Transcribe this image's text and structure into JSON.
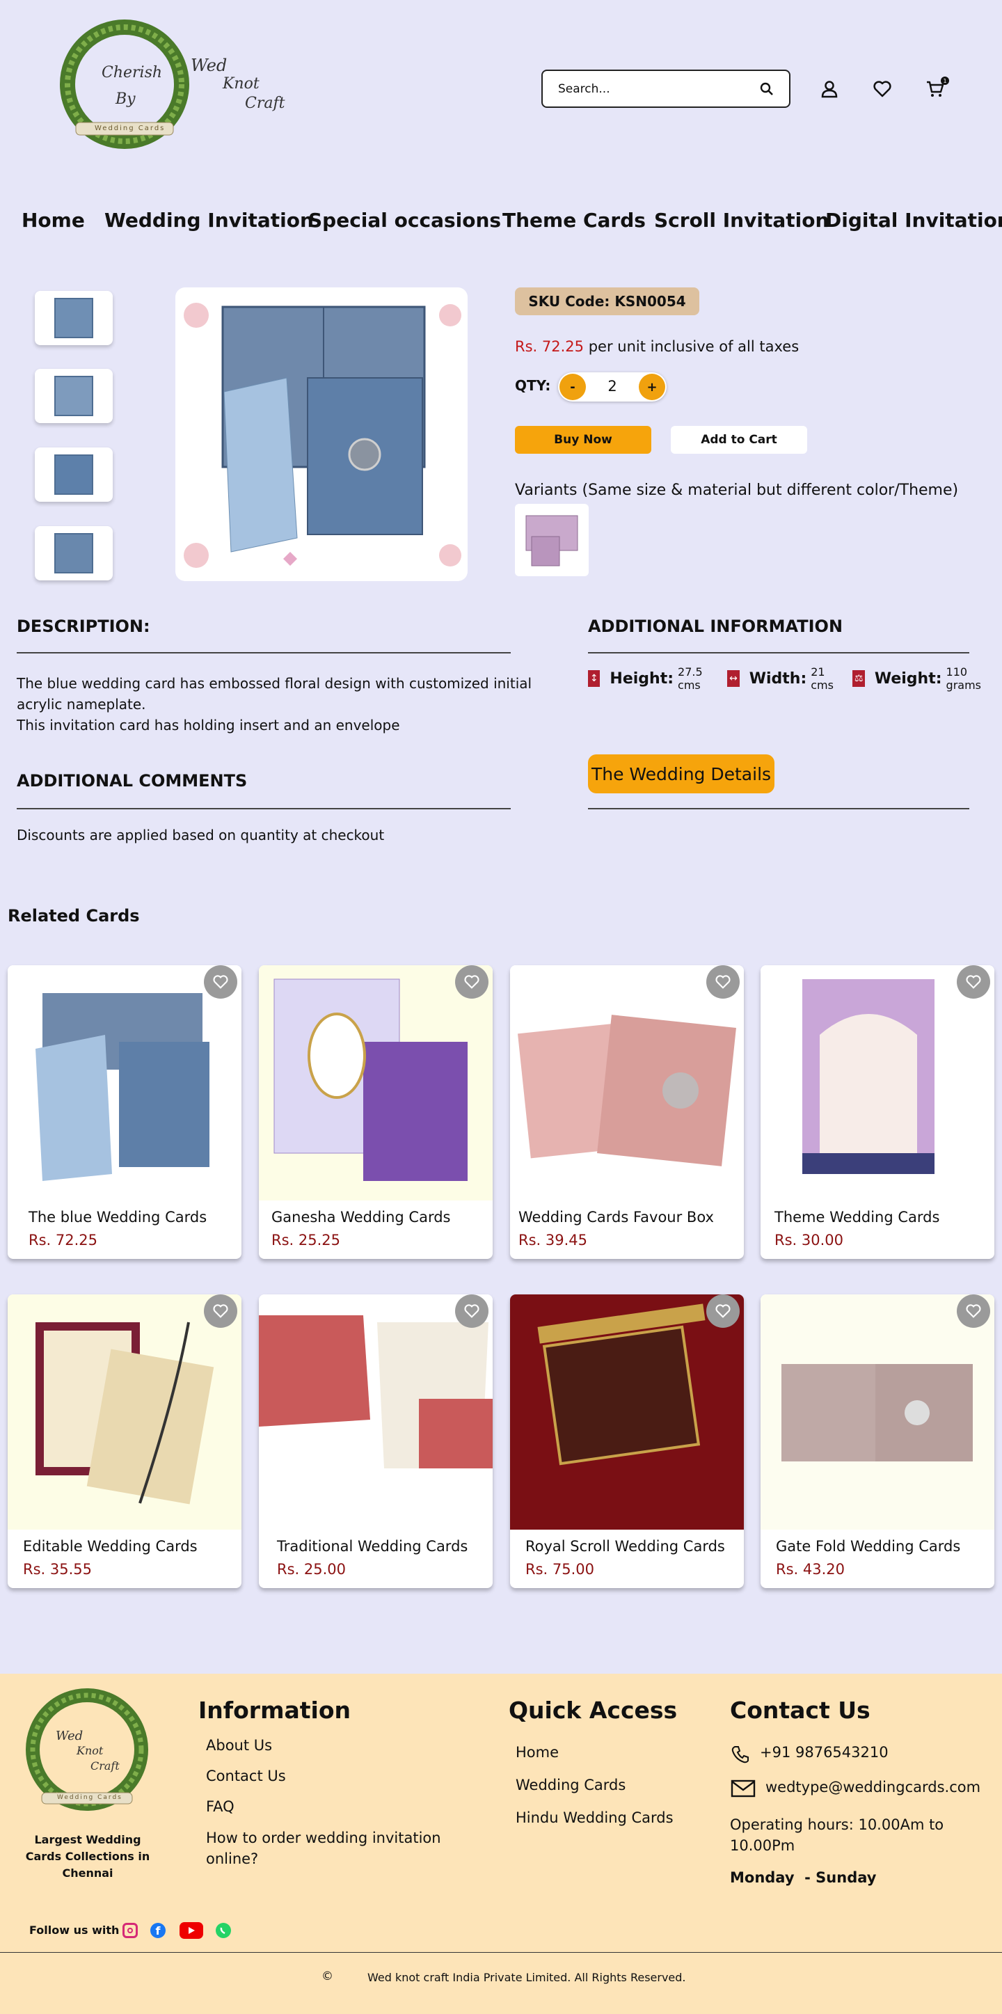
{
  "header": {
    "logo_text": [
      "Cherish",
      "By",
      "Wed",
      "Knot",
      "Craft",
      "Wedding Cards"
    ],
    "search_placeholder": "Search...",
    "cart_count": "1"
  },
  "nav": [
    "Home",
    "Wedding Invitation",
    "Special occasions",
    "Theme Cards",
    "Scroll Invitation",
    "Digital Invitation"
  ],
  "product": {
    "sku": "SKU Code: KSN0054",
    "price": "Rs. 72.25",
    "price_suffix": "per unit inclusive of all taxes",
    "qty_label": "QTY:",
    "qty_minus": "-",
    "qty_value": "2",
    "qty_plus": "+",
    "buy_now": "Buy Now",
    "add_to_cart": "Add to Cart",
    "variants_label": "Variants (Same size & material but different color/Theme)"
  },
  "description": {
    "heading": "DESCRIPTION:",
    "line1": "The blue wedding card has embossed floral design with customized initial acrylic nameplate.",
    "line2": "This invitation card has holding insert and an envelope"
  },
  "additional_comments": {
    "heading": "ADDITIONAL COMMENTS",
    "text": "Discounts are applied based on quantity at checkout"
  },
  "additional_info": {
    "heading": "ADDITIONAL INFORMATION",
    "height_label": "Height:",
    "height_value": "27.5 cms",
    "width_label": "Width:",
    "width_value": "21 cms",
    "weight_label": "Weight:",
    "weight_value": "110 grams",
    "details_button": "The Wedding Details"
  },
  "related": {
    "heading": "Related Cards",
    "cards": [
      {
        "name": "The blue Wedding Cards",
        "price": "Rs. 72.25"
      },
      {
        "name": "Ganesha Wedding Cards",
        "price": "Rs. 25.25"
      },
      {
        "name": "Wedding Cards Favour Box",
        "price": "Rs. 39.45"
      },
      {
        "name": "Theme Wedding Cards",
        "price": "Rs. 30.00"
      },
      {
        "name": "Editable Wedding Cards",
        "price": "Rs. 35.55"
      },
      {
        "name": "Traditional Wedding Cards",
        "price": "Rs. 25.00"
      },
      {
        "name": "Royal Scroll Wedding Cards",
        "price": "Rs. 75.00"
      },
      {
        "name": "Gate Fold Wedding Cards",
        "price": "Rs. 43.20"
      }
    ]
  },
  "footer": {
    "tagline": "Largest Wedding Cards Collections in Chennai",
    "info_heading": "Information",
    "info_links": [
      "About Us",
      "Contact Us",
      "FAQ",
      "How to order wedding invitation online?"
    ],
    "quick_heading": "Quick Access",
    "quick_links": [
      "Home",
      "Wedding Cards",
      "Hindu Wedding Cards"
    ],
    "contact_heading": "Contact Us",
    "phone": "+91 9876543210",
    "email": "wedtype@weddingcards.com",
    "hours": "Operating hours: 10.00Am to 10.00Pm",
    "days": "Monday  - Sunday",
    "follow": "Follow us with",
    "copyright_symbol": "©",
    "copyright": "Wed knot craft India Private Limited. All Rights Reserved."
  },
  "colors": {
    "background": "#e6e6f8",
    "accent": "#f6a40c",
    "sku_bg": "#ddc19f",
    "footer_bg": "#fde4b8",
    "price_red": "#c41818"
  }
}
